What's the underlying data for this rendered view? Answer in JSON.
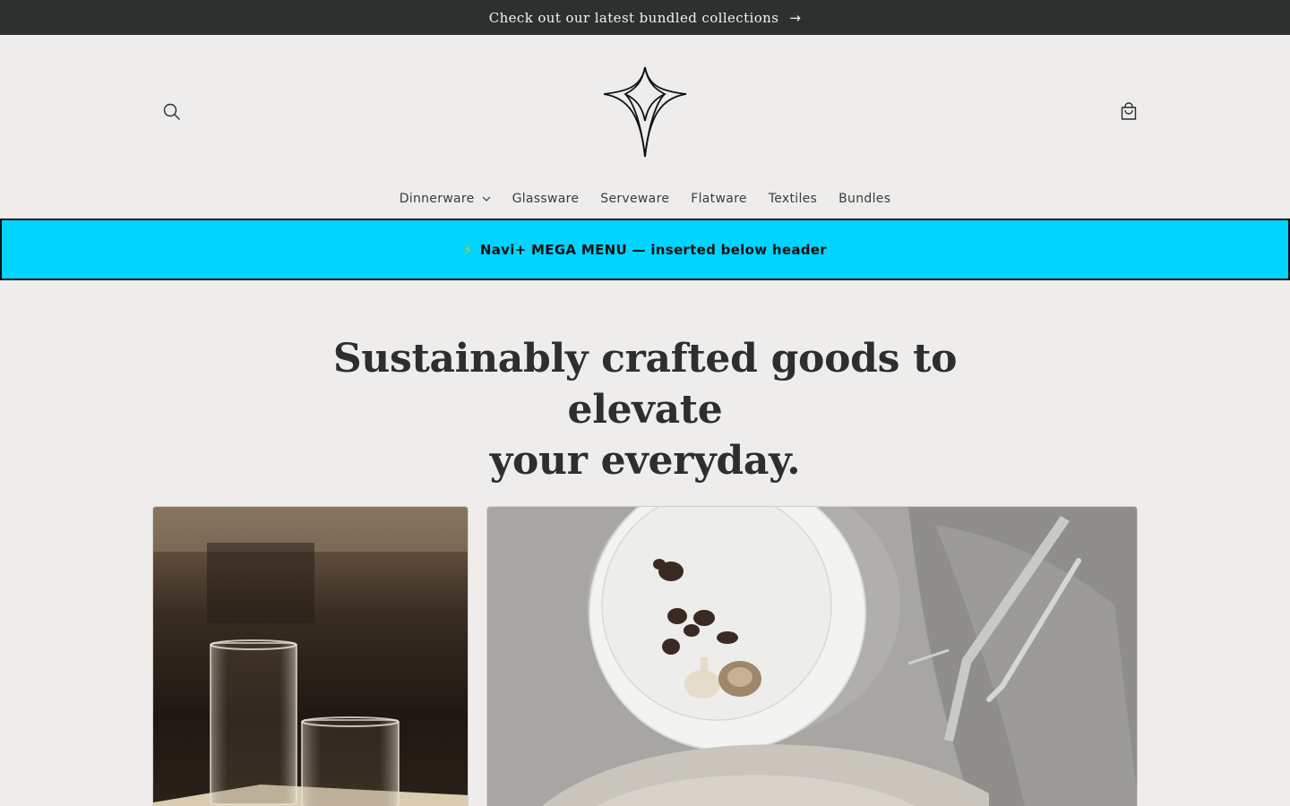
{
  "announcement": {
    "text": "Check out our latest bundled collections",
    "arrow": "→"
  },
  "header": {
    "search_icon": "search-icon",
    "cart_icon": "cart-icon",
    "logo_icon": "star-logo-icon"
  },
  "nav": {
    "items": [
      {
        "label": "Dinnerware",
        "has_dropdown": true
      },
      {
        "label": "Glassware"
      },
      {
        "label": "Serveware"
      },
      {
        "label": "Flatware"
      },
      {
        "label": "Textiles"
      },
      {
        "label": "Bundles"
      }
    ]
  },
  "mega_menu": {
    "bolt": "⚡",
    "text": "Navi+ MEGA MENU — inserted below header",
    "background": "#00d4ff"
  },
  "hero": {
    "title_line1": "Sustainably crafted goods to elevate",
    "title_line2": "your everyday."
  },
  "colors": {
    "page_bg": "#eeedeb",
    "announcement_bg": "#2c302e",
    "accent": "#00d4ff"
  }
}
